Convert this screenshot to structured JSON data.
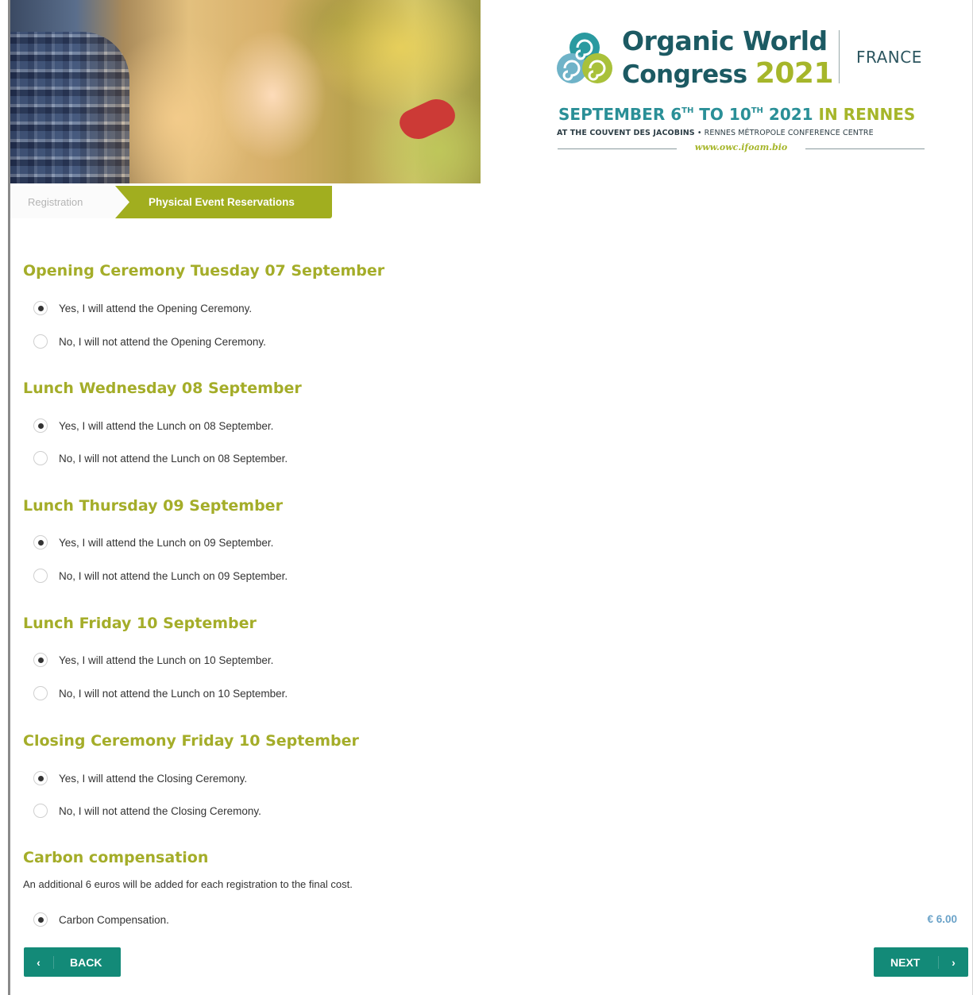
{
  "header": {
    "logo_line1": "Organic World",
    "logo_line2_word": "Congress",
    "logo_year": "2021",
    "country": "FRANCE",
    "dates_part1": "SEPTEMBER 6",
    "dates_sup1": "TH",
    "dates_part2": " TO 10",
    "dates_sup2": "TH",
    "dates_part3": " 2021 ",
    "dates_city": "IN RENNES",
    "venue_bold": "AT THE COUVENT DES JACOBINS",
    "venue_rest": " • RENNES MÉTROPOLE CONFERENCE CENTRE",
    "url": "www.owc.ifoam.bio"
  },
  "steps": {
    "step1": "Registration",
    "step2": "Physical Event Reservations"
  },
  "sections": [
    {
      "title": "Opening Ceremony Tuesday 07 September",
      "options": [
        {
          "label": "Yes, I will attend the Opening Ceremony.",
          "checked": true
        },
        {
          "label": "No, I will not attend the Opening Ceremony.",
          "checked": false
        }
      ]
    },
    {
      "title": "Lunch Wednesday 08 September",
      "options": [
        {
          "label": "Yes, I will attend the Lunch on 08 September.",
          "checked": true
        },
        {
          "label": "No, I will not attend the Lunch on 08 September.",
          "checked": false
        }
      ]
    },
    {
      "title": "Lunch Thursday 09 September",
      "options": [
        {
          "label": "Yes, I will attend the Lunch on 09 September.",
          "checked": true
        },
        {
          "label": "No, I will not attend the Lunch on 09 September.",
          "checked": false
        }
      ]
    },
    {
      "title": "Lunch Friday 10 September",
      "options": [
        {
          "label": "Yes, I will attend the Lunch on 10 September.",
          "checked": true
        },
        {
          "label": "No, I will not attend the Lunch on 10 September.",
          "checked": false
        }
      ]
    },
    {
      "title": "Closing Ceremony Friday 10 September",
      "options": [
        {
          "label": "Yes, I will attend the Closing Ceremony.",
          "checked": true
        },
        {
          "label": "No, I will not attend the Closing Ceremony.",
          "checked": false
        }
      ]
    }
  ],
  "carbon": {
    "title": "Carbon compensation",
    "note": "An additional 6 euros will be added for each registration to the final cost.",
    "option_label": "Carbon Compensation.",
    "checked": true,
    "price": "€ 6.00"
  },
  "buttons": {
    "back_label": "BACK",
    "back_icon": "‹",
    "next_label": "NEXT",
    "next_icon": "›"
  },
  "colors": {
    "accent_green": "#a4ad29",
    "teal_button": "#138a78",
    "price_blue": "#6aa2c8"
  }
}
